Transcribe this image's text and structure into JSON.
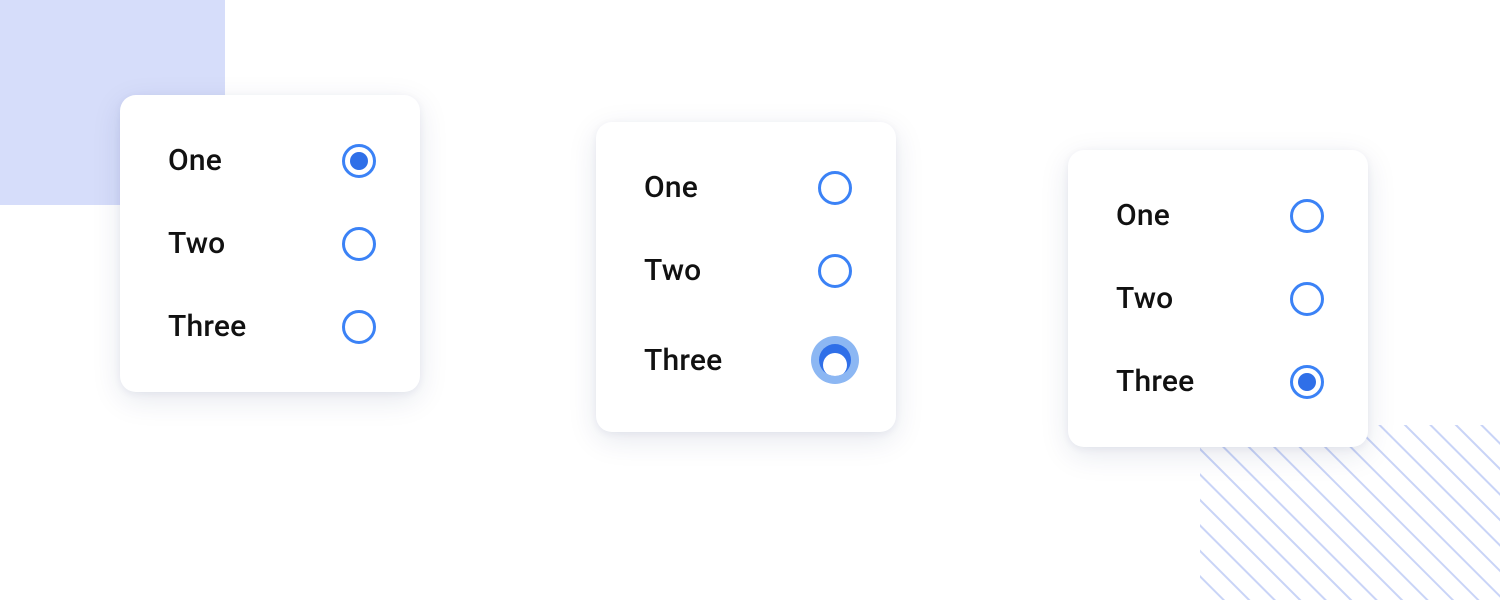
{
  "colors": {
    "radio_border": "#3b82f6",
    "radio_fill": "#2f6fe8",
    "halo": "#8cb7f3",
    "deco_square": "#d6ddfa",
    "deco_hatch": "#c9d4f7"
  },
  "cards": [
    {
      "id": "default",
      "options": [
        {
          "label": "One",
          "state": "selected"
        },
        {
          "label": "Two",
          "state": "unselected"
        },
        {
          "label": "Three",
          "state": "unselected"
        }
      ]
    },
    {
      "id": "touching",
      "options": [
        {
          "label": "One",
          "state": "unselected"
        },
        {
          "label": "Two",
          "state": "unselected"
        },
        {
          "label": "Three",
          "state": "touching"
        }
      ]
    },
    {
      "id": "moved",
      "options": [
        {
          "label": "One",
          "state": "unselected"
        },
        {
          "label": "Two",
          "state": "unselected"
        },
        {
          "label": "Three",
          "state": "selected"
        }
      ]
    }
  ]
}
